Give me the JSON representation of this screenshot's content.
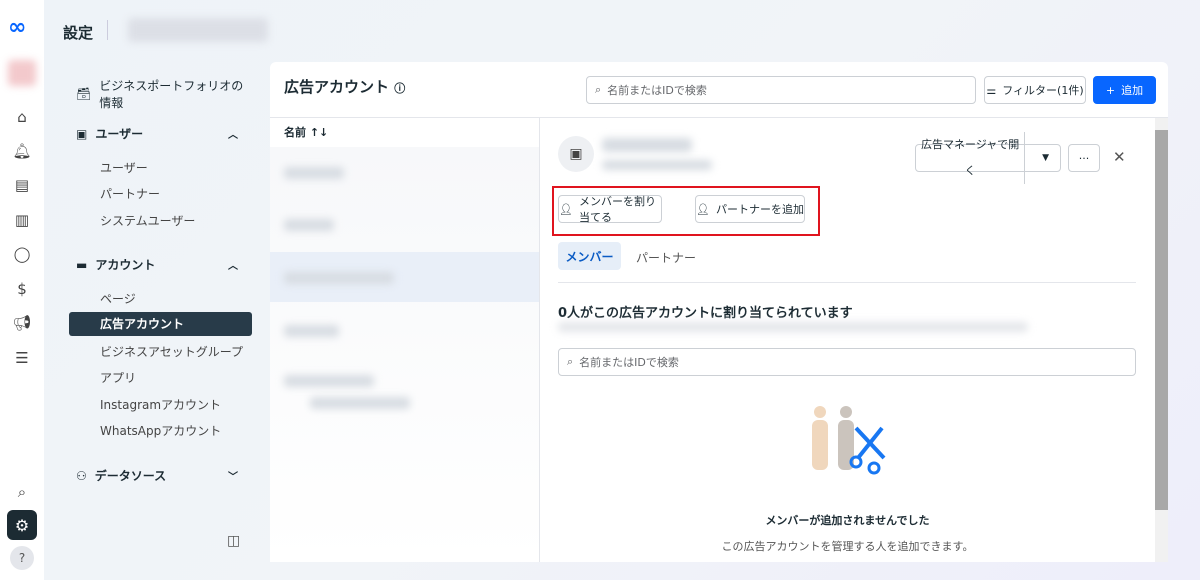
{
  "header": {
    "title": "設定"
  },
  "sidebar": {
    "business_info": "ビジネスポートフォリオの情報",
    "users_section": "ユーザー",
    "users_items": [
      "ユーザー",
      "パートナー",
      "システムユーザー"
    ],
    "accounts_section": "アカウント",
    "accounts_items": [
      "ページ",
      "広告アカウント",
      "ビジネスアセットグループ",
      "アプリ",
      "Instagramアカウント",
      "WhatsAppアカウント"
    ],
    "datasource_section": "データソース"
  },
  "main": {
    "title": "広告アカウント",
    "search_placeholder": "名前またはIDで検索",
    "filter_label": "フィルター(1件)",
    "add_label": "追加",
    "column_name": "名前",
    "sort_icon": "↑↓"
  },
  "detail": {
    "open_ads_manager": "広告マネージャで開く",
    "assign_member": "メンバーを割り当てる",
    "add_partner": "パートナーを追加",
    "tabs": [
      "メンバー",
      "パートナー"
    ],
    "assigned_heading": "0人がこの広告アカウントに割り当てられています",
    "search_placeholder": "名前またはIDで検索",
    "empty_title": "メンバーが追加されませんでした",
    "empty_desc": "この広告アカウントを管理する人を追加できます。"
  },
  "colors": {
    "accent": "#0866ff",
    "highlight": "#e0141e",
    "active_nav": "#283b49"
  }
}
